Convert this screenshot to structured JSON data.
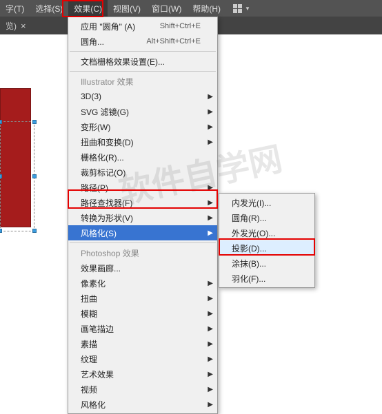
{
  "menubar": {
    "items": [
      {
        "label": "字(T)"
      },
      {
        "label": "选择(S)"
      },
      {
        "label": "效果(C)"
      },
      {
        "label": "视图(V)"
      },
      {
        "label": "窗口(W)"
      },
      {
        "label": "帮助(H)"
      }
    ]
  },
  "tab": {
    "label": "览)",
    "close": "×"
  },
  "dropdown": {
    "recent": [
      {
        "label": "应用 \"圆角\" (A)",
        "shortcut": "Shift+Ctrl+E"
      },
      {
        "label": "圆角...",
        "shortcut": "Alt+Shift+Ctrl+E"
      }
    ],
    "doc_setting": "文档栅格效果设置(E)...",
    "group1_header": "Illustrator 效果",
    "group1": [
      {
        "label": "3D(3)",
        "arrow": true
      },
      {
        "label": "SVG 滤镜(G)",
        "arrow": true
      },
      {
        "label": "变形(W)",
        "arrow": true
      },
      {
        "label": "扭曲和变换(D)",
        "arrow": true
      },
      {
        "label": "栅格化(R)...",
        "arrow": false
      },
      {
        "label": "裁剪标记(O)",
        "arrow": false
      },
      {
        "label": "路径(P)",
        "arrow": true
      },
      {
        "label": "路径查找器(F)",
        "arrow": true
      },
      {
        "label": "转换为形状(V)",
        "arrow": true
      },
      {
        "label": "风格化(S)",
        "arrow": true,
        "selected": true
      }
    ],
    "group2_header": "Photoshop 效果",
    "group2": [
      {
        "label": "效果画廊...",
        "arrow": false
      },
      {
        "label": "像素化",
        "arrow": true
      },
      {
        "label": "扭曲",
        "arrow": true
      },
      {
        "label": "模糊",
        "arrow": true
      },
      {
        "label": "画笔描边",
        "arrow": true
      },
      {
        "label": "素描",
        "arrow": true
      },
      {
        "label": "纹理",
        "arrow": true
      },
      {
        "label": "艺术效果",
        "arrow": true
      },
      {
        "label": "视频",
        "arrow": true
      },
      {
        "label": "风格化",
        "arrow": true
      }
    ]
  },
  "submenu": {
    "items": [
      {
        "label": "内发光(I)..."
      },
      {
        "label": "圆角(R)..."
      },
      {
        "label": "外发光(O)..."
      },
      {
        "label": "投影(D)...",
        "hover": true
      },
      {
        "label": "涂抹(B)..."
      },
      {
        "label": "羽化(F)..."
      }
    ]
  },
  "watermark": "软件自学网"
}
